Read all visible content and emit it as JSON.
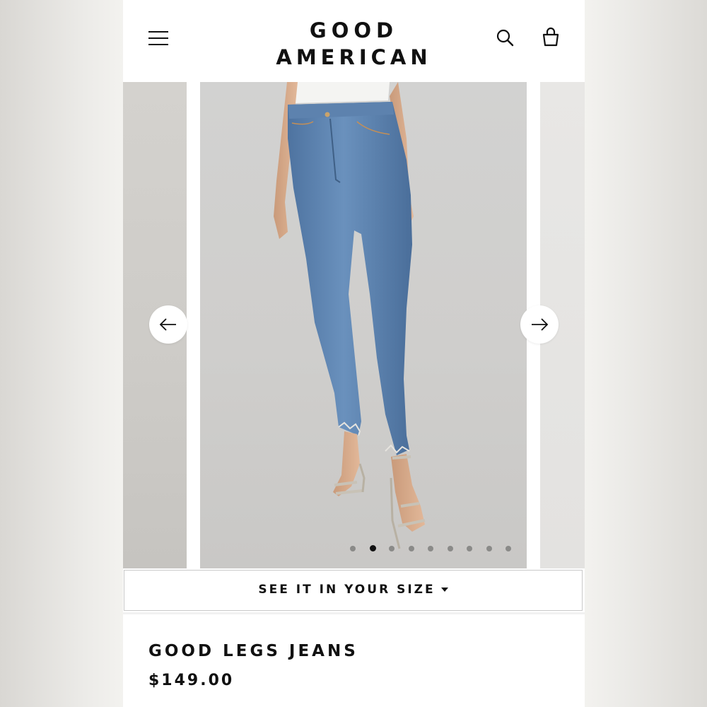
{
  "brand": {
    "line1": "GOOD",
    "line2": "AMERICAN"
  },
  "header": {
    "menu_icon": "hamburger-menu-icon",
    "search_icon": "search-icon",
    "bag_icon": "shopping-bag-icon"
  },
  "gallery": {
    "slide_count": 9,
    "active_index": 1,
    "prev_icon": "arrow-left-icon",
    "next_icon": "arrow-right-icon"
  },
  "size_button": {
    "label": "SEE IT IN YOUR SIZE",
    "icon": "caret-down-icon"
  },
  "product": {
    "title": "GOOD LEGS JEANS",
    "price": "$149.00"
  },
  "colors": {
    "text": "#111111",
    "denim": "#5f86b3",
    "background": "#ffffff"
  }
}
